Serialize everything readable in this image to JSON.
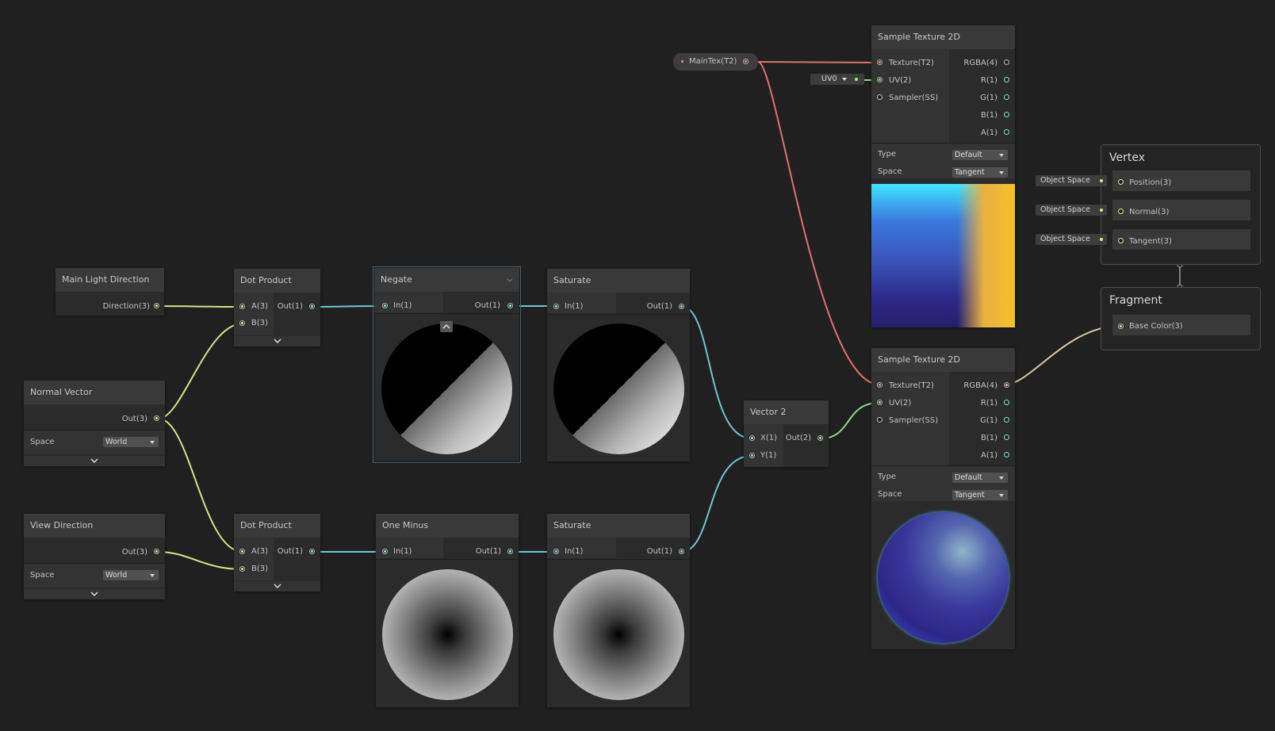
{
  "colors": {
    "background": "#202020",
    "wire_vector3": "#d8e08a",
    "wire_float": "#6fc5d2",
    "wire_vector2": "#8fd58a",
    "wire_texture": "#e07070",
    "wire_color": "#d9c7a8",
    "port_vector3": "#e7e68e",
    "port_float": "#84e4e7",
    "port_vector2": "#9bf07c",
    "port_texture": "#ff8b8b",
    "port_color": "#f0b9e8",
    "selection": "#44647a"
  },
  "nodes": {
    "main_light": {
      "title": "Main Light Direction",
      "out": "Direction(3)"
    },
    "normal_vector": {
      "title": "Normal Vector",
      "out": "Out(3)",
      "space_label": "Space",
      "space_value": "World"
    },
    "view_direction": {
      "title": "View Direction",
      "out": "Out(3)",
      "space_label": "Space",
      "space_value": "World"
    },
    "dot_top": {
      "title": "Dot Product",
      "in_a": "A(3)",
      "in_b": "B(3)",
      "out": "Out(1)"
    },
    "dot_bottom": {
      "title": "Dot Product",
      "in_a": "A(3)",
      "in_b": "B(3)",
      "out": "Out(1)"
    },
    "negate": {
      "title": "Negate",
      "in": "In(1)",
      "out": "Out(1)"
    },
    "one_minus": {
      "title": "One Minus",
      "in": "In(1)",
      "out": "Out(1)"
    },
    "saturate_top": {
      "title": "Saturate",
      "in": "In(1)",
      "out": "Out(1)"
    },
    "saturate_bottom": {
      "title": "Saturate",
      "in": "In(1)",
      "out": "Out(1)"
    },
    "vector2": {
      "title": "Vector 2",
      "in_x": "X(1)",
      "in_y": "Y(1)",
      "out": "Out(2)"
    },
    "maintex": {
      "label": "MainTex(T2)"
    },
    "uv_chip": {
      "value": "UV0"
    },
    "sample_top": {
      "title": "Sample Texture 2D",
      "inputs": [
        "Texture(T2)",
        "UV(2)",
        "Sampler(SS)"
      ],
      "outputs": [
        "RGBA(4)",
        "R(1)",
        "G(1)",
        "B(1)",
        "A(1)"
      ],
      "type_label": "Type",
      "type_value": "Default",
      "space_label": "Space",
      "space_value": "Tangent"
    },
    "sample_bottom": {
      "title": "Sample Texture 2D",
      "inputs": [
        "Texture(T2)",
        "UV(2)",
        "Sampler(SS)"
      ],
      "outputs": [
        "RGBA(4)",
        "R(1)",
        "G(1)",
        "B(1)",
        "A(1)"
      ],
      "type_label": "Type",
      "type_value": "Default",
      "space_label": "Space",
      "space_value": "Tangent"
    }
  },
  "vertex": {
    "title": "Vertex",
    "slots": [
      {
        "chip": "Object Space",
        "label": "Position(3)"
      },
      {
        "chip": "Object Space",
        "label": "Normal(3)"
      },
      {
        "chip": "Object Space",
        "label": "Tangent(3)"
      }
    ]
  },
  "fragment": {
    "title": "Fragment",
    "slots": [
      {
        "label": "Base Color(3)"
      }
    ]
  }
}
